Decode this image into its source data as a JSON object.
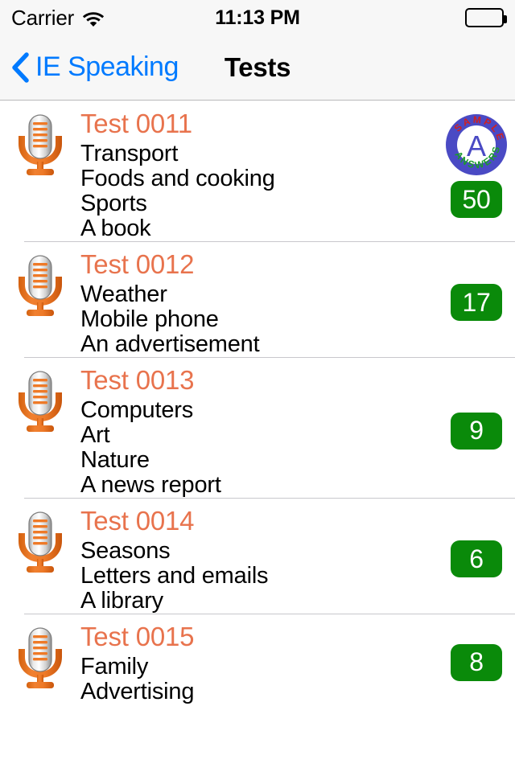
{
  "status_bar": {
    "carrier": "Carrier",
    "wifi_icon": "wifi-icon",
    "time": "11:13 PM",
    "battery_icon": "battery-full-icon"
  },
  "nav_bar": {
    "back_icon": "chevron-left-icon",
    "back_label": "IE Speaking",
    "title": "Tests"
  },
  "colors": {
    "accent_orange": "#e8734d",
    "ios_blue": "#007aff",
    "badge_green": "#0a8a0a",
    "separator": "#c8c7cc",
    "bar_background": "#f7f7f7"
  },
  "sample_badge": {
    "icon": "sample-answers-badge-icon",
    "top_text": "SAMPLE",
    "center_letter": "A",
    "bottom_text": "ANSWERS"
  },
  "list": {
    "rows": [
      {
        "icon": "microphone-icon",
        "title": "Test 0011",
        "topics": [
          "Transport",
          "Foods and cooking",
          "Sports",
          "A book"
        ],
        "count": "50",
        "has_sample_answers": true
      },
      {
        "icon": "microphone-icon",
        "title": "Test 0012",
        "topics": [
          "Weather",
          "Mobile phone",
          "An advertisement"
        ],
        "count": "17",
        "has_sample_answers": false
      },
      {
        "icon": "microphone-icon",
        "title": "Test 0013",
        "topics": [
          "Computers",
          "Art",
          "Nature",
          "A news report"
        ],
        "count": "9",
        "has_sample_answers": false
      },
      {
        "icon": "microphone-icon",
        "title": "Test 0014",
        "topics": [
          "Seasons",
          "Letters and emails",
          "A library"
        ],
        "count": "6",
        "has_sample_answers": false
      },
      {
        "icon": "microphone-icon",
        "title": "Test 0015",
        "topics": [
          "Family",
          "Advertising"
        ],
        "count": "8",
        "has_sample_answers": false
      }
    ]
  }
}
